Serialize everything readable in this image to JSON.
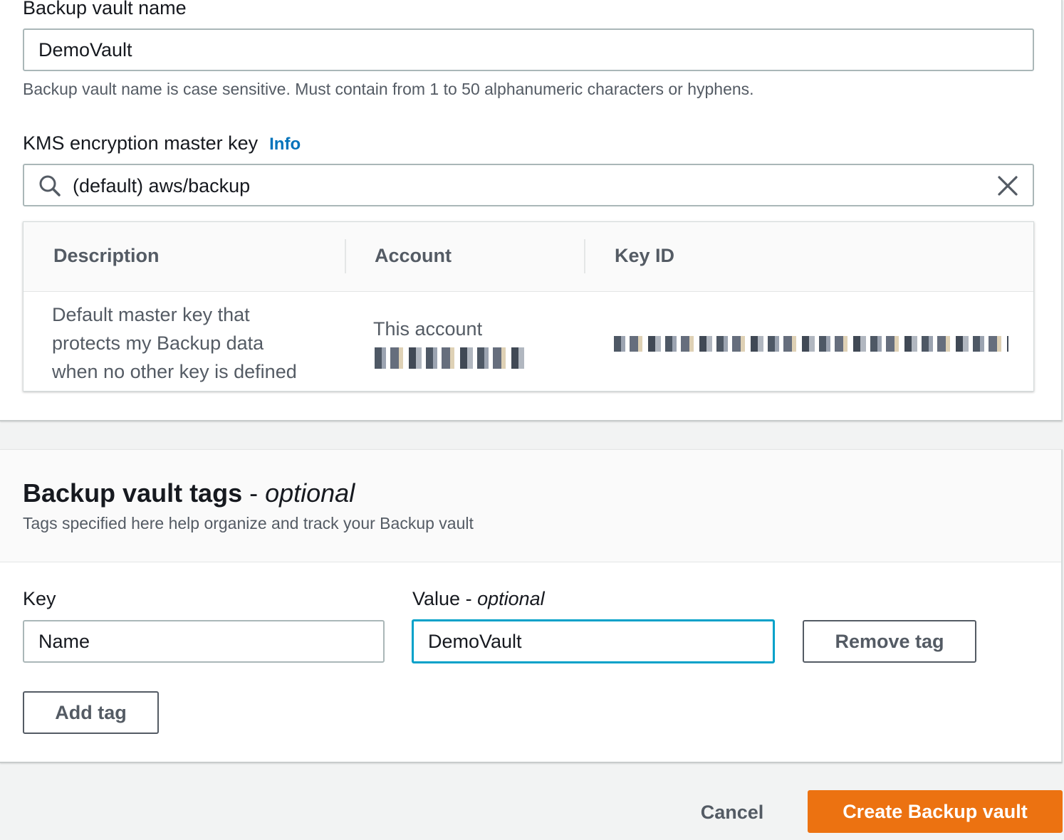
{
  "vault_name": {
    "label": "Backup vault name",
    "value": "DemoVault",
    "help": "Backup vault name is case sensitive. Must contain from 1 to 50 alphanumeric characters or hyphens."
  },
  "kms": {
    "label": "KMS encryption master key",
    "info_link": "Info",
    "search_value": "(default) aws/backup",
    "table": {
      "columns": [
        "Description",
        "Account",
        "Key ID"
      ],
      "row": {
        "description_lines": [
          "Default master key that",
          "protects my Backup data",
          "when no other key is defined"
        ],
        "account": "This account"
      }
    }
  },
  "tags": {
    "title": "Backup vault tags",
    "title_dash": " - ",
    "title_optional": "optional",
    "description": "Tags specified here help organize and track your Backup vault",
    "key_label": "Key",
    "value_label": "Value",
    "value_label_dash": " - ",
    "value_label_optional": "optional",
    "key_value": "Name",
    "value_value": "DemoVault",
    "remove_button": "Remove tag",
    "add_button": "Add tag"
  },
  "footer": {
    "cancel": "Cancel",
    "create": "Create Backup vault"
  },
  "colors": {
    "primary": "#ec7211",
    "link": "#0073bb",
    "focus": "#00a1c9"
  },
  "icons": {
    "search": "search-icon",
    "clear": "close-icon"
  }
}
